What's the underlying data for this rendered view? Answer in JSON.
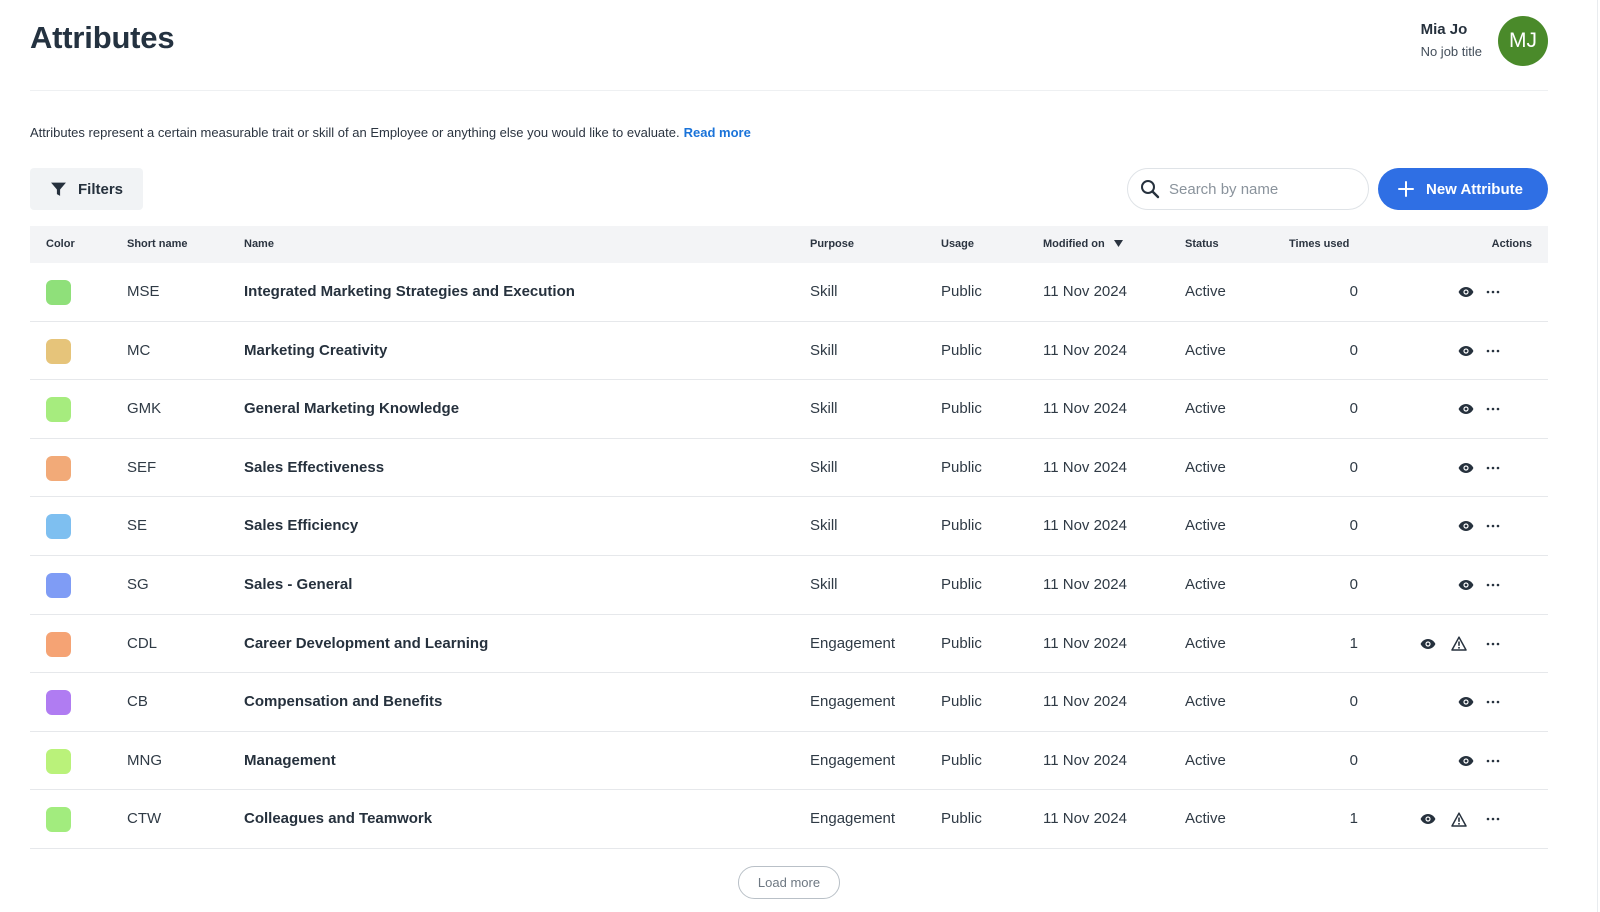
{
  "header": {
    "title": "Attributes",
    "user": {
      "name": "Mia Jo",
      "job_title": "No job title",
      "initials": "MJ",
      "avatar_color": "#4a8a2a"
    }
  },
  "description": {
    "text": "Attributes represent a certain measurable trait or skill of an Employee or anything else you would like to evaluate.",
    "link": "Read more"
  },
  "toolbar": {
    "filters_label": "Filters",
    "search_placeholder": "Search by name",
    "new_button_label": "New Attribute",
    "accent_color": "#2f6fe4"
  },
  "table": {
    "columns": {
      "color": "Color",
      "short_name": "Short name",
      "name": "Name",
      "purpose": "Purpose",
      "usage": "Usage",
      "modified_on": "Modified on",
      "status": "Status",
      "times_used": "Times used",
      "actions": "Actions"
    },
    "sort": {
      "column": "modified_on",
      "direction": "descending",
      "icon": "caret-down-icon"
    },
    "rows": [
      {
        "color": "#8fe07a",
        "short": "MSE",
        "name": "Integrated Marketing Strategies and Execution",
        "purpose": "Skill",
        "usage": "Public",
        "modified": "11 Nov 2024",
        "status": "Active",
        "times": "0",
        "warning": false
      },
      {
        "color": "#e6c47a",
        "short": "MC",
        "name": "Marketing Creativity",
        "purpose": "Skill",
        "usage": "Public",
        "modified": "11 Nov 2024",
        "status": "Active",
        "times": "0",
        "warning": false
      },
      {
        "color": "#a6ec7e",
        "short": "GMK",
        "name": "General Marketing Knowledge",
        "purpose": "Skill",
        "usage": "Public",
        "modified": "11 Nov 2024",
        "status": "Active",
        "times": "0",
        "warning": false
      },
      {
        "color": "#f2aa78",
        "short": "SEF",
        "name": "Sales Effectiveness",
        "purpose": "Skill",
        "usage": "Public",
        "modified": "11 Nov 2024",
        "status": "Active",
        "times": "0",
        "warning": false
      },
      {
        "color": "#7ebff0",
        "short": "SE",
        "name": "Sales Efficiency",
        "purpose": "Skill",
        "usage": "Public",
        "modified": "11 Nov 2024",
        "status": "Active",
        "times": "0",
        "warning": false
      },
      {
        "color": "#7f9cf5",
        "short": "SG",
        "name": "Sales - General",
        "purpose": "Skill",
        "usage": "Public",
        "modified": "11 Nov 2024",
        "status": "Active",
        "times": "0",
        "warning": false
      },
      {
        "color": "#f5a374",
        "short": "CDL",
        "name": "Career Development and Learning",
        "purpose": "Engagement",
        "usage": "Public",
        "modified": "11 Nov 2024",
        "status": "Active",
        "times": "1",
        "warning": true
      },
      {
        "color": "#b07cf2",
        "short": "CB",
        "name": "Compensation and Benefits",
        "purpose": "Engagement",
        "usage": "Public",
        "modified": "11 Nov 2024",
        "status": "Active",
        "times": "0",
        "warning": false
      },
      {
        "color": "#baf27a",
        "short": "MNG",
        "name": "Management",
        "purpose": "Engagement",
        "usage": "Public",
        "modified": "11 Nov 2024",
        "status": "Active",
        "times": "0",
        "warning": false
      },
      {
        "color": "#a2ec7e",
        "short": "CTW",
        "name": "Colleagues and Teamwork",
        "purpose": "Engagement",
        "usage": "Public",
        "modified": "11 Nov 2024",
        "status": "Active",
        "times": "1",
        "warning": true
      }
    ],
    "row_icons": {
      "view": "eye-icon",
      "warning": "warning-triangle-icon",
      "more": "more-horizontal-icon"
    }
  },
  "footer": {
    "load_more_label": "Load more"
  }
}
